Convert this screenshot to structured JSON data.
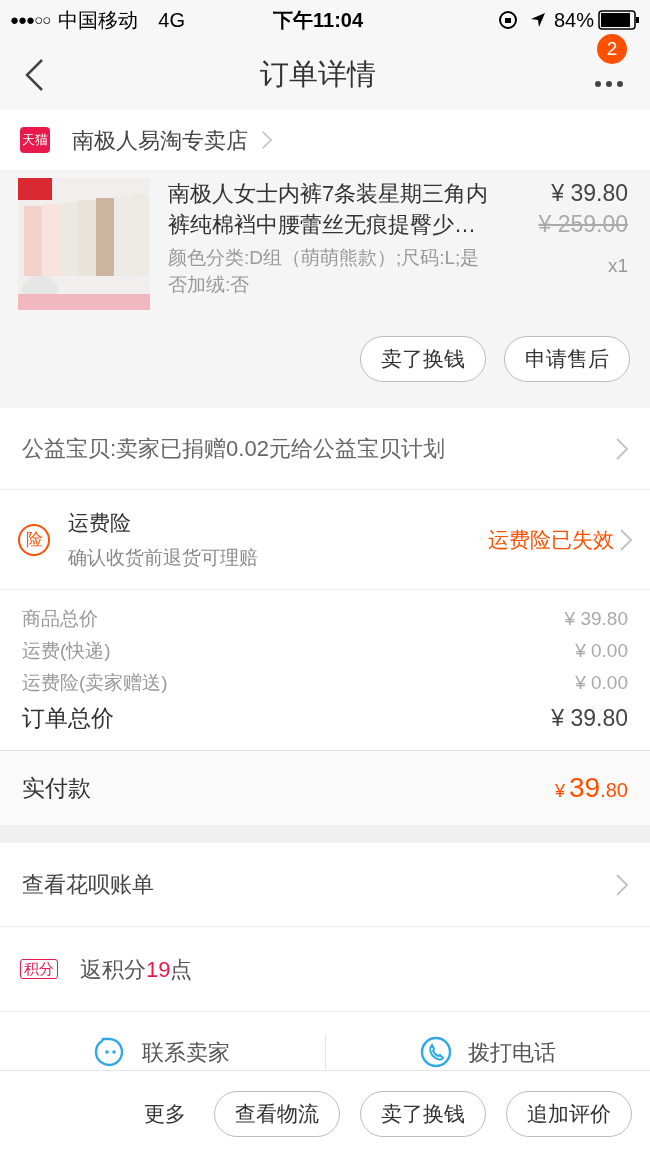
{
  "status_bar": {
    "signal": "●●●○○",
    "carrier": "中国移动",
    "network": "4G",
    "time": "下午11:04",
    "battery": "84%"
  },
  "nav": {
    "title": "订单详情",
    "badge": "2"
  },
  "shop": {
    "badge": "天猫",
    "name": "南极人易淘专卖店"
  },
  "product": {
    "title": "南极人女士内裤7条装星期三角内裤纯棉裆中腰蕾丝无痕提臀少…",
    "specs": "颜色分类:D组（萌萌熊款）;尺码:L;是否加绒:否",
    "price": "¥ 39.80",
    "original_price": "¥ 259.00",
    "quantity": "x1",
    "buttons": [
      "卖了换钱",
      "申请售后"
    ]
  },
  "charity": {
    "text": "公益宝贝:卖家已捐赠0.02元给公益宝贝计划"
  },
  "insurance": {
    "icon": "险",
    "title": "运费险",
    "subtitle": "确认收货前退货可理赔",
    "status": "运费险已失效"
  },
  "totals": [
    {
      "label": "商品总价",
      "value": "¥ 39.80",
      "kind": "minor"
    },
    {
      "label": "运费(快递)",
      "value": "¥ 0.00",
      "kind": "minor"
    },
    {
      "label": "运费险(卖家赠送)",
      "value": "¥ 0.00",
      "kind": "minor"
    },
    {
      "label": "订单总价",
      "value": "¥ 39.80",
      "kind": "major"
    }
  ],
  "paid": {
    "label": "实付款",
    "symbol": "¥",
    "integer": "39",
    "decimal": ".80"
  },
  "huabei": {
    "text": "查看花呗账单"
  },
  "points": {
    "badge": "积分",
    "prefix": "返积分",
    "value": "19",
    "suffix": "点"
  },
  "contact": [
    {
      "label": "联系卖家",
      "kind": "chat"
    },
    {
      "label": "拨打电话",
      "kind": "phone"
    }
  ],
  "bottom_bar": {
    "more": "更多",
    "buttons": [
      "查看物流",
      "卖了换钱",
      "追加评价"
    ]
  }
}
